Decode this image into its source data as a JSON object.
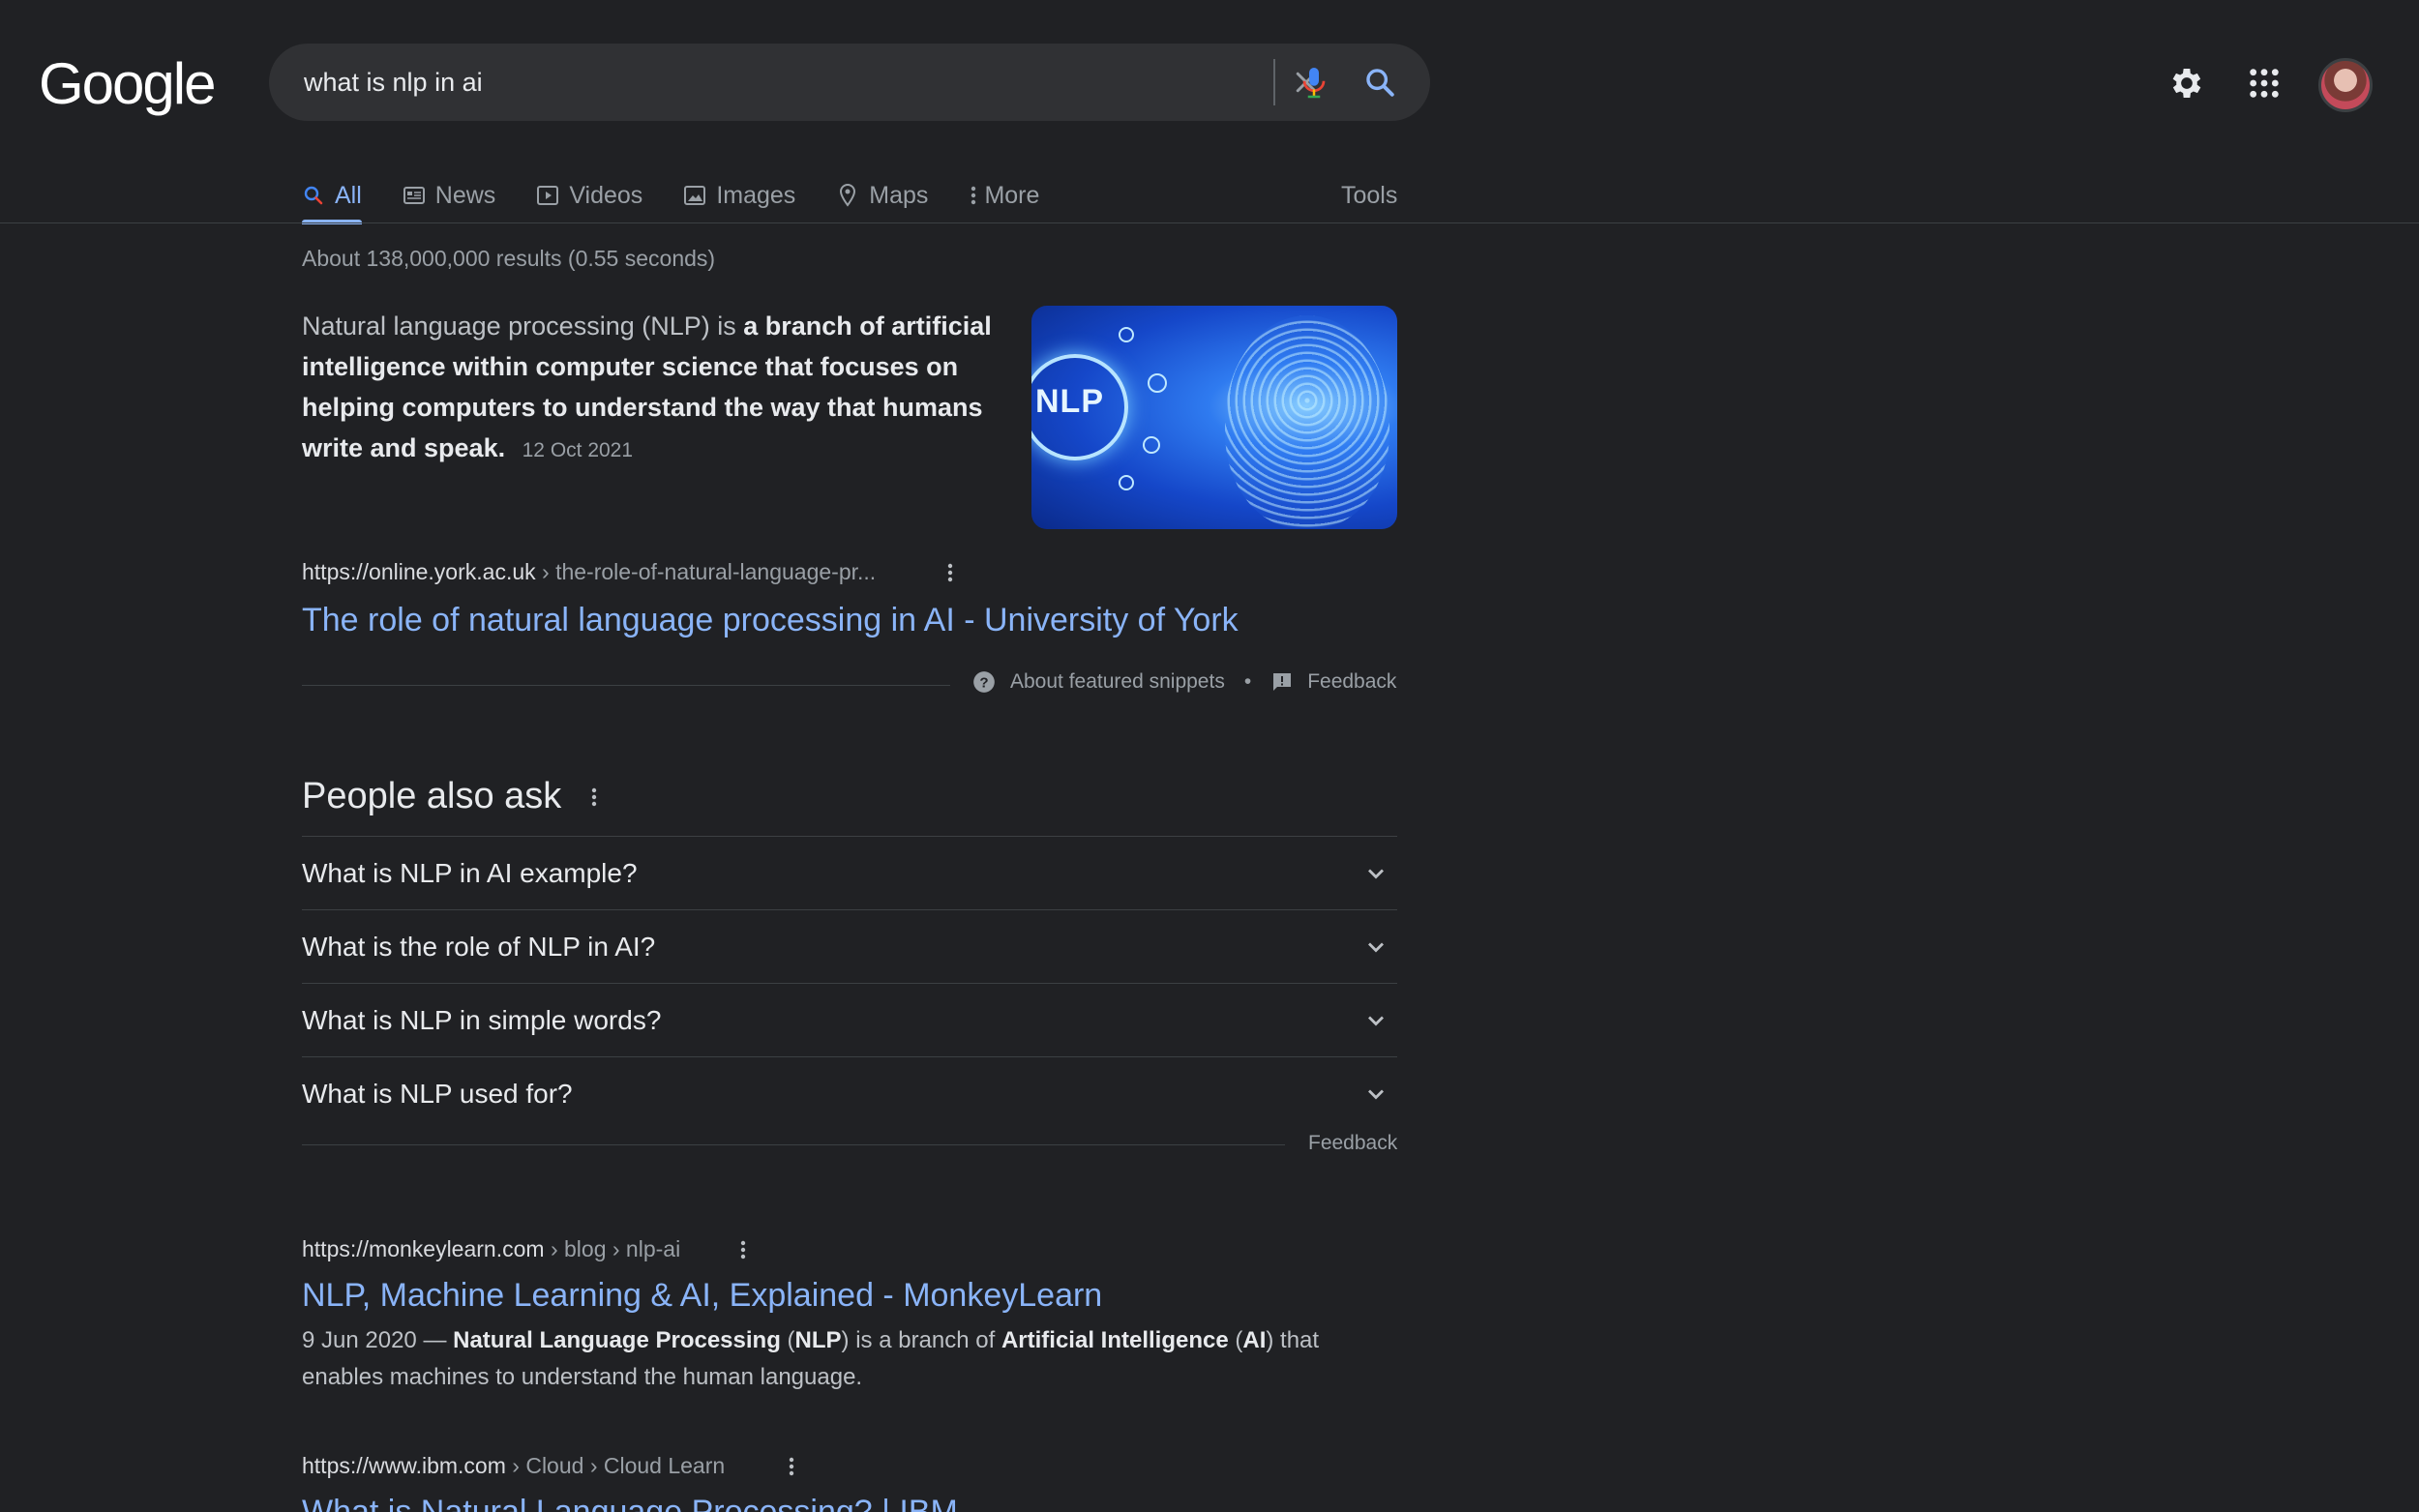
{
  "header": {
    "logo_text": "Google",
    "search_query": "what is nlp in ai"
  },
  "tabs": [
    {
      "label": "All",
      "icon": "search-icon",
      "active": true
    },
    {
      "label": "News",
      "icon": "news-icon"
    },
    {
      "label": "Videos",
      "icon": "play-icon"
    },
    {
      "label": "Images",
      "icon": "image-icon"
    },
    {
      "label": "Maps",
      "icon": "map-pin-icon"
    },
    {
      "label": "More",
      "icon": "more-vert-icon"
    }
  ],
  "tools_label": "Tools",
  "result_stats": "About 138,000,000 results (0.55 seconds)",
  "featured_snippet": {
    "text_plain": "Natural language processing (NLP) is ",
    "text_bold": "a branch of artificial intelligence within computer science that focuses on helping computers to understand the way that humans write and speak",
    "text_end": ".",
    "date": "12 Oct 2021",
    "image_label": "NLP",
    "url_domain": "https://online.york.ac.uk",
    "url_path": " › the-role-of-natural-language-pr...",
    "title": "The role of natural language processing in AI - University of York",
    "about_label": "About featured snippets",
    "separator": "•",
    "feedback_label": "Feedback"
  },
  "people_also_ask": {
    "title": "People also ask",
    "questions": [
      "What is NLP in AI example?",
      "What is the role of NLP in AI?",
      "What is NLP in simple words?",
      "What is NLP used for?"
    ],
    "feedback_label": "Feedback"
  },
  "results": [
    {
      "url_domain": "https://monkeylearn.com",
      "url_path": " › blog › nlp-ai",
      "title": "NLP, Machine Learning & AI, Explained - MonkeyLearn",
      "desc_parts": [
        {
          "t": "9 Jun 2020 — ",
          "b": false
        },
        {
          "t": "Natural Language Processing",
          "b": true
        },
        {
          "t": " (",
          "b": false
        },
        {
          "t": "NLP",
          "b": true
        },
        {
          "t": ") is a branch of ",
          "b": false
        },
        {
          "t": "Artificial Intelligence",
          "b": true
        },
        {
          "t": " (",
          "b": false
        },
        {
          "t": "AI",
          "b": true
        },
        {
          "t": ") that enables machines to understand the human language.",
          "b": false
        }
      ]
    },
    {
      "url_domain": "https://www.ibm.com",
      "url_path": " › Cloud › Cloud Learn",
      "title": "What is Natural Language Processing? | IBM"
    }
  ],
  "colors": {
    "background": "#202124",
    "link": "#8ab4f8",
    "text": "#bdc1c6"
  }
}
